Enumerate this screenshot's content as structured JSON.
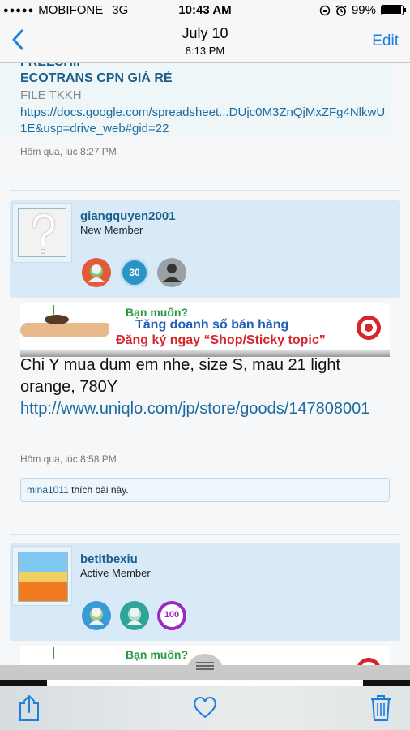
{
  "status_bar": {
    "signal": "●●●●●",
    "carrier": "MOBIFONE",
    "network": "3G",
    "time": "10:43 AM",
    "battery_percent": "99%",
    "battery_level": 0.99
  },
  "nav": {
    "title": "July 10",
    "subtitle": "8:13 PM",
    "edit_label": "Edit"
  },
  "post_top": {
    "line1": "FREESHIP",
    "line2": "ECOTRANS CPN GIÁ RẺ",
    "line3": "FILE TKKH",
    "link": "https://docs.google.com/spreadsheet...DUjc0M3ZnQjMxZFg4NlkwU1E&usp=drive_web#gid=22",
    "time": "Hôm qua, lúc 8:27 PM"
  },
  "user1": {
    "username": "giangquyen2001",
    "role": "New Member",
    "badge2": "30"
  },
  "banner": {
    "line1": "Bạn muốn?",
    "line2": "Tăng doanh số bán hàng",
    "line3": "Đăng ký ngay “Shop/Sticky topic”"
  },
  "post2": {
    "text": "Chi Y mua dum em nhe, size S, mau 21 light orange, 780Y",
    "link": "http://www.uniqlo.com/jp/store/goods/147808001",
    "time": "Hôm qua, lúc 8:58 PM",
    "like_user": "mina1011",
    "like_text": " thích bài này."
  },
  "user2": {
    "username": "betitbexiu",
    "role": "Active Member",
    "badge3": "100"
  },
  "banner2": {
    "line1": "Bạn muốn?"
  },
  "icons": {
    "share": "share-icon",
    "heart": "heart-icon",
    "trash": "trash-icon"
  },
  "colors": {
    "accent": "#1a7fe0",
    "link": "#1b6aa0",
    "username": "#1b5e8a",
    "card_bg": "#d8eaf8"
  }
}
